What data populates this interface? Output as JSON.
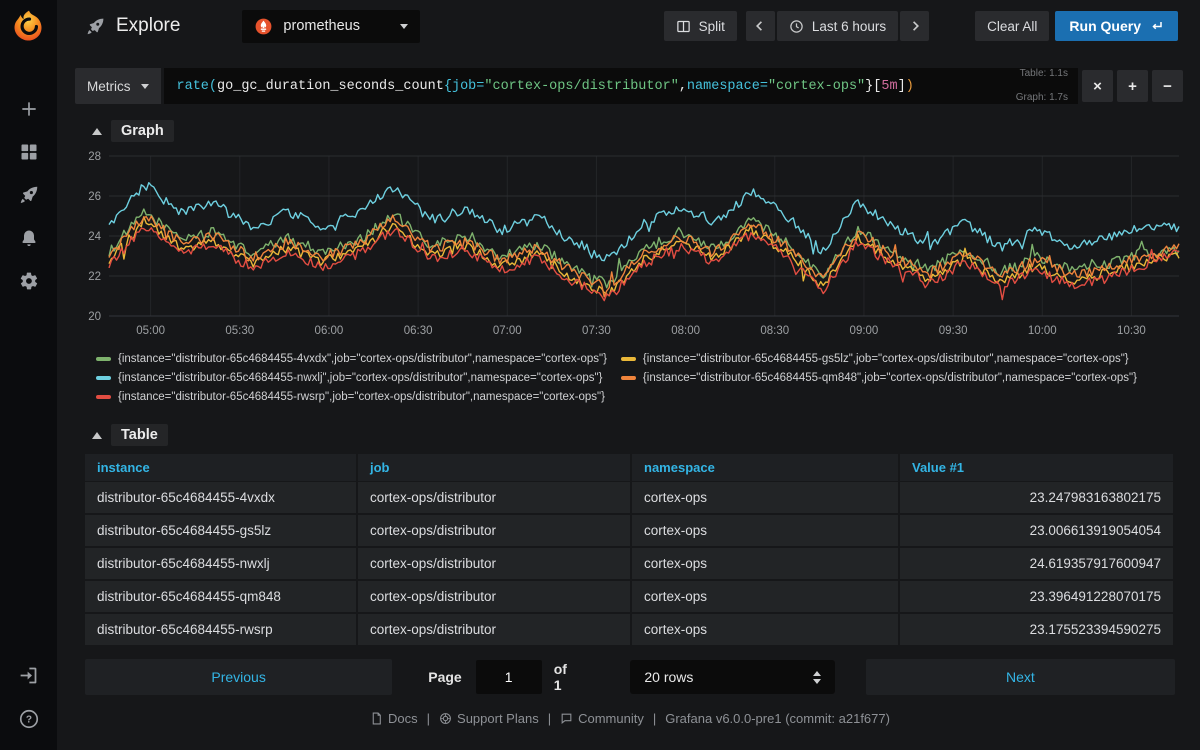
{
  "sidebar": {
    "logo_icon": "grafana-logo",
    "items": [
      {
        "name": "create",
        "icon": "plus-icon"
      },
      {
        "name": "dashboards",
        "icon": "grid-icon"
      },
      {
        "name": "explore",
        "icon": "rocket-icon"
      },
      {
        "name": "alerting",
        "icon": "bell-icon"
      },
      {
        "name": "configuration",
        "icon": "gear-icon"
      }
    ],
    "bottom_items": [
      {
        "name": "sign-in",
        "icon": "sign-in-icon"
      },
      {
        "name": "help",
        "icon": "help-circle-icon"
      }
    ]
  },
  "topnav": {
    "title": "Explore",
    "title_icon": "rocket-icon",
    "datasource": "prometheus",
    "datasource_icon": "prometheus-icon",
    "split_label": "Split",
    "time_range": "Last 6 hours",
    "clear_all_label": "Clear All",
    "run_query_label": "Run Query"
  },
  "query_row": {
    "metrics_label": "Metrics",
    "segments": [
      {
        "t": "rate(",
        "c": "fn"
      },
      {
        "t": "go_gc_duration_seconds_count",
        "c": "metric"
      },
      {
        "t": "{",
        "c": "fn"
      },
      {
        "t": "job=",
        "c": "label"
      },
      {
        "t": "\"cortex-ops/distributor\"",
        "c": "str"
      },
      {
        "t": ",",
        "c": "plain"
      },
      {
        "t": "namespace=",
        "c": "label"
      },
      {
        "t": "\"cortex-ops\"",
        "c": "str"
      },
      {
        "t": "}",
        "c": "plain"
      },
      {
        "t": "[",
        "c": "plain"
      },
      {
        "t": "5m",
        "c": "dur"
      },
      {
        "t": "]",
        "c": "plain"
      },
      {
        "t": ")",
        "c": "paren"
      }
    ],
    "timing": {
      "table_time": "Table: 1.1s",
      "graph_time": "Graph: 1.7s"
    },
    "close_label": "×",
    "add_label": "+",
    "remove_label": "−"
  },
  "graph_panel": {
    "title": "Graph",
    "legend_order": [
      0,
      2,
      4,
      1,
      3
    ]
  },
  "chart_data": {
    "type": "line",
    "title": "Graph",
    "x_start": "04:46",
    "x_end": "10:46",
    "x_ticks": [
      "05:00",
      "05:30",
      "06:00",
      "06:30",
      "07:00",
      "07:30",
      "08:00",
      "08:30",
      "09:00",
      "09:30",
      "10:00",
      "10:30"
    ],
    "ylim": [
      20,
      28
    ],
    "y_ticks": [
      20,
      22,
      24,
      26,
      28
    ],
    "grid": true,
    "legend_position": "bottom",
    "noise_amplitude": 0.5,
    "series": [
      {
        "name": "{instance=\"distributor-65c4684455-4vxdx\",job=\"cortex-ops/distributor\",namespace=\"cortex-ops\"}",
        "color": "#7eb26d",
        "values": [
          23.2,
          25.2,
          23.9,
          24.2,
          23.1,
          23.9,
          23.2,
          23.8,
          25.1,
          23.5,
          24.0,
          23.0,
          23.6,
          22.4,
          21.6,
          23.3,
          24.2,
          23.4,
          24.8,
          23.7,
          22.0,
          24.4,
          23.2,
          22.3,
          23.4,
          22.2,
          23.0,
          22.3,
          22.6,
          23.2,
          23.2
        ]
      },
      {
        "name": "{instance=\"distributor-65c4684455-gs5lz\",job=\"cortex-ops/distributor\",namespace=\"cortex-ops\"}",
        "color": "#eab839",
        "values": [
          22.7,
          24.7,
          23.4,
          23.7,
          22.6,
          23.4,
          22.7,
          23.3,
          24.6,
          23.0,
          23.5,
          22.5,
          23.1,
          21.9,
          21.1,
          22.8,
          23.7,
          22.9,
          24.3,
          23.2,
          21.5,
          23.9,
          22.7,
          21.8,
          22.9,
          21.7,
          22.5,
          21.8,
          22.1,
          22.7,
          23.0
        ]
      },
      {
        "name": "{instance=\"distributor-65c4684455-nwxlj\",job=\"cortex-ops/distributor\",namespace=\"cortex-ops\"}",
        "color": "#6ed0e0",
        "values": [
          24.4,
          26.6,
          25.2,
          25.6,
          24.4,
          25.2,
          24.5,
          25.1,
          26.5,
          24.8,
          25.3,
          24.3,
          24.9,
          23.7,
          22.8,
          24.6,
          25.5,
          24.7,
          26.2,
          25.0,
          23.2,
          25.7,
          24.5,
          23.5,
          24.7,
          23.4,
          24.3,
          23.5,
          23.9,
          24.5,
          24.6
        ]
      },
      {
        "name": "{instance=\"distributor-65c4684455-qm848\",job=\"cortex-ops/distributor\",namespace=\"cortex-ops\"}",
        "color": "#ef843c",
        "values": [
          23.0,
          25.0,
          23.7,
          24.0,
          22.9,
          23.7,
          23.0,
          23.6,
          24.9,
          23.3,
          23.8,
          22.8,
          23.4,
          22.2,
          21.4,
          23.1,
          24.0,
          23.2,
          24.6,
          23.5,
          21.8,
          24.2,
          23.0,
          22.1,
          23.2,
          22.0,
          22.8,
          22.1,
          22.4,
          23.0,
          23.4
        ]
      },
      {
        "name": "{instance=\"distributor-65c4684455-rwsrp\",job=\"cortex-ops/distributor\",namespace=\"cortex-ops\"}",
        "color": "#e24d42",
        "values": [
          22.5,
          24.5,
          23.2,
          23.5,
          22.4,
          23.2,
          22.5,
          23.1,
          24.4,
          22.8,
          23.3,
          22.3,
          22.9,
          21.7,
          20.9,
          22.6,
          23.5,
          22.7,
          24.1,
          23.0,
          21.3,
          23.7,
          22.5,
          21.6,
          22.7,
          21.5,
          22.3,
          21.6,
          21.9,
          22.5,
          23.2
        ]
      }
    ]
  },
  "table_panel": {
    "title": "Table",
    "columns": [
      "instance",
      "job",
      "namespace",
      "Value #1"
    ],
    "rows": [
      [
        "distributor-65c4684455-4vxdx",
        "cortex-ops/distributor",
        "cortex-ops",
        "23.247983163802175"
      ],
      [
        "distributor-65c4684455-gs5lz",
        "cortex-ops/distributor",
        "cortex-ops",
        "23.006613919054054"
      ],
      [
        "distributor-65c4684455-nwxlj",
        "cortex-ops/distributor",
        "cortex-ops",
        "24.619357917600947"
      ],
      [
        "distributor-65c4684455-qm848",
        "cortex-ops/distributor",
        "cortex-ops",
        "23.396491228070175"
      ],
      [
        "distributor-65c4684455-rwsrp",
        "cortex-ops/distributor",
        "cortex-ops",
        "23.175523394590275"
      ]
    ]
  },
  "pagination": {
    "previous_label": "Previous",
    "page_label": "Page",
    "page_value": "1",
    "of_label": "of 1",
    "rows_select_value": "20 rows",
    "next_label": "Next"
  },
  "footer": {
    "links": [
      "Docs",
      "Support Plans",
      "Community"
    ],
    "separator": "|",
    "version": "Grafana v6.0.0-pre1 (commit: a21f677)"
  },
  "colors": {
    "accent_blue": "#33b5e5",
    "run_query_blue": "#1b6fb1",
    "body_bg": "#161719",
    "sidebar_bg": "#0b0c0e",
    "cell_bg": "#222426"
  }
}
